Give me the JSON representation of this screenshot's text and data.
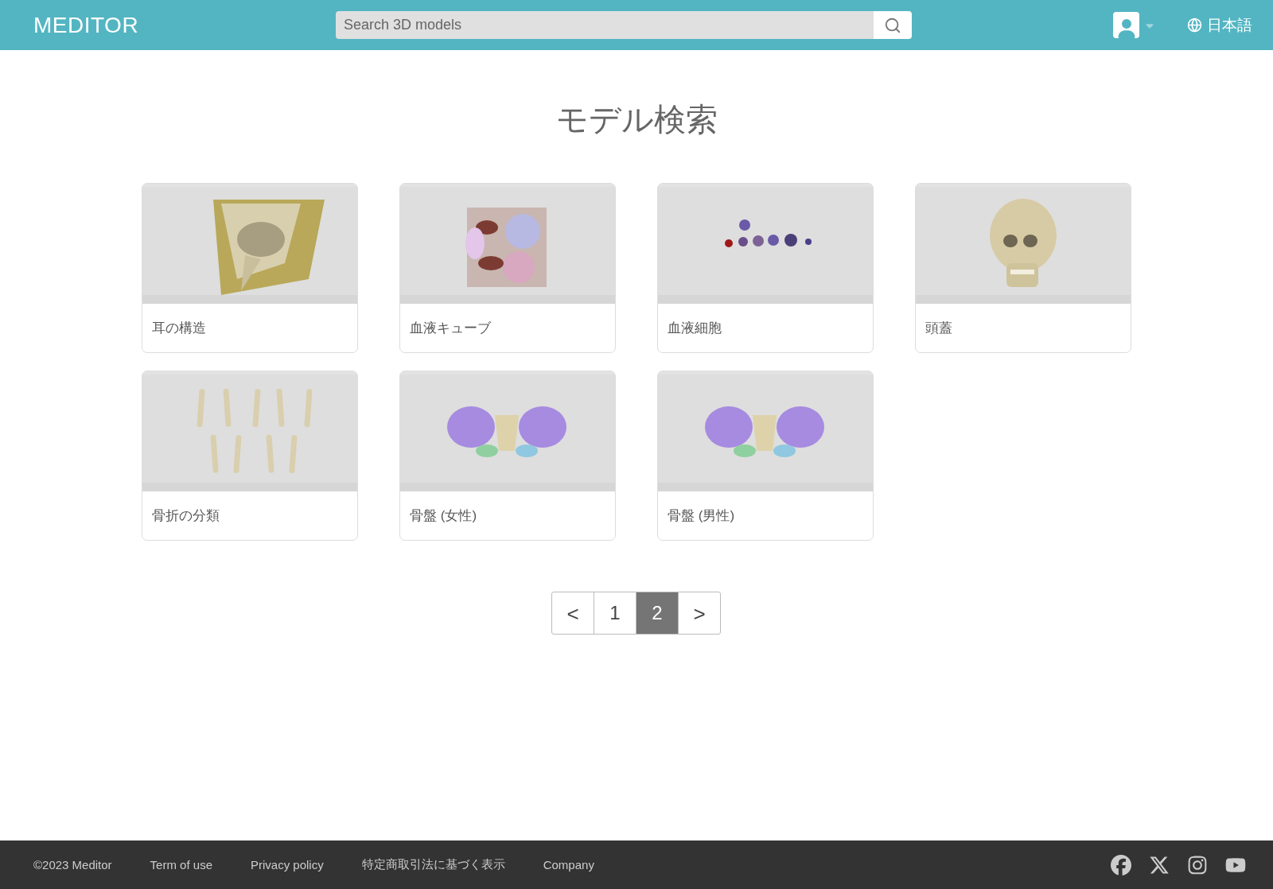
{
  "header": {
    "logo": "MEDITOR",
    "search": {
      "placeholder": "Search 3D models"
    },
    "language": "日本語"
  },
  "title": "モデル検索",
  "cards": [
    {
      "title": "耳の構造"
    },
    {
      "title": "血液キューブ"
    },
    {
      "title": "血液細胞"
    },
    {
      "title": "頭蓋"
    },
    {
      "title": "骨折の分類"
    },
    {
      "title": "骨盤 (女性)"
    },
    {
      "title": "骨盤 (男性)"
    }
  ],
  "pagination": [
    {
      "label": "<",
      "kind": "prev",
      "selected": false
    },
    {
      "label": "1",
      "kind": "page",
      "selected": false
    },
    {
      "label": "2",
      "kind": "page",
      "selected": true
    },
    {
      "label": ">",
      "kind": "next",
      "selected": false
    }
  ],
  "footer": {
    "copyright": "©2023 Meditor",
    "links": [
      "Term of use",
      "Privacy policy",
      "特定商取引法に基づく表示",
      "Company"
    ]
  }
}
